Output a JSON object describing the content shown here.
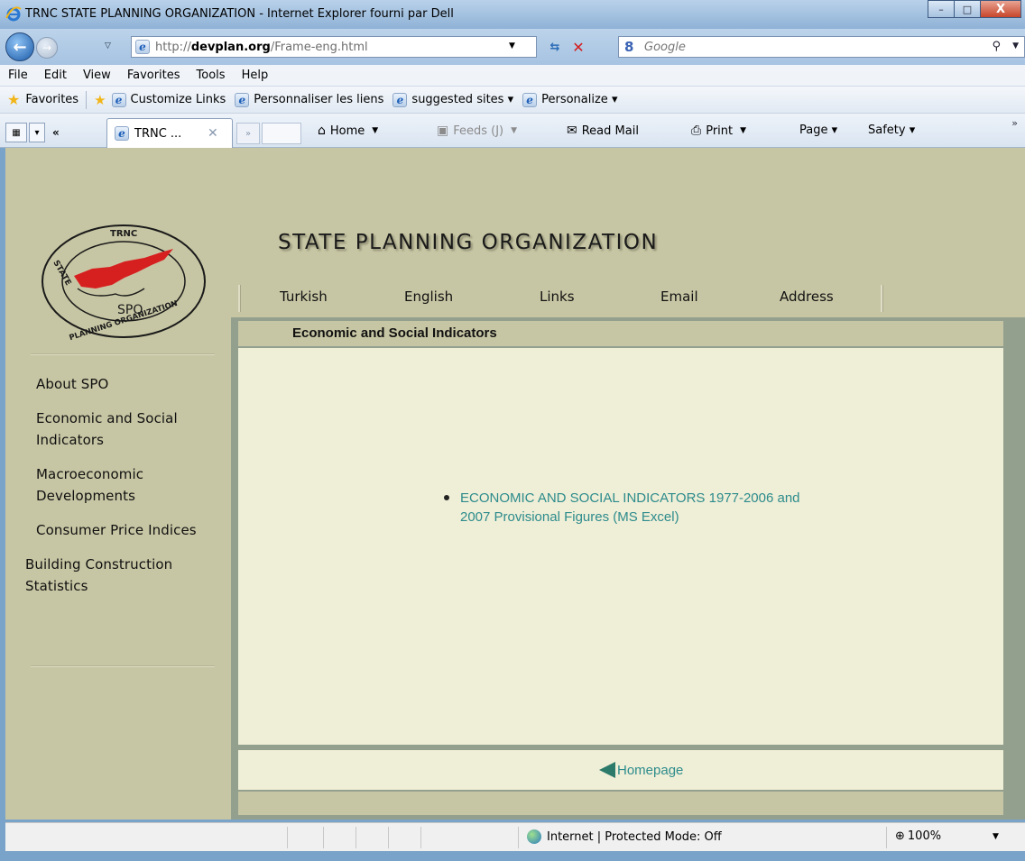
{
  "window": {
    "title": "TRNC STATE PLANNING ORGANIZATION - Internet Explorer fourni par Dell",
    "buttons": {
      "minimize": "–",
      "maximize": "□",
      "close": "X"
    }
  },
  "address": {
    "url_prefix": "http://",
    "url_domain": "devplan.org",
    "url_path": "/Frame-eng.html",
    "search_provider": "Google",
    "search_logo": "8"
  },
  "menu": [
    "File",
    "Edit",
    "View",
    "Favorites",
    "Tools",
    "Help"
  ],
  "favorites_bar": {
    "favorites_label": "Favorites",
    "links": [
      "Customize Links",
      "Personnaliser les liens",
      "suggested sites ▾",
      "Personalize ▾"
    ]
  },
  "tabs": {
    "active_label": "TRNC ...",
    "prev": "«",
    "next": "»"
  },
  "commands": {
    "home": "Home",
    "feeds": "Feeds (J)",
    "read_mail": "Read Mail",
    "print": "Print",
    "page": "Page ▾",
    "safety": "Safety ▾",
    "overflow": "»"
  },
  "site": {
    "logo": {
      "top": "TRNC",
      "left": "STATE",
      "center": "SPO",
      "bottom": "PLANNING ORGANIZATION"
    },
    "banner_title": "STATE PLANNING ORGANIZATION",
    "top_nav": [
      "Turkish",
      "English",
      "Links",
      "Email",
      "Address"
    ],
    "side_nav": [
      "About SPO",
      "Economic and Social Indicators",
      "Macroeconomic Developments",
      "Consumer Price Indices",
      "Building Construction Statistics"
    ],
    "section_title": "Economic and Social Indicators",
    "download_link": "ECONOMIC AND SOCIAL INDICATORS 1977-2006 and 2007 Provisional Figures (MS Excel)",
    "home_link": "Homepage"
  },
  "statusbar": {
    "zone": "Internet | Protected Mode: Off",
    "zoom": "100%"
  },
  "colors": {
    "page_bg": "#c7c6a4",
    "content_bg": "#efeed7",
    "link": "#2d8c8c",
    "frame": "#94a08e",
    "logo_red": "#d62020"
  }
}
